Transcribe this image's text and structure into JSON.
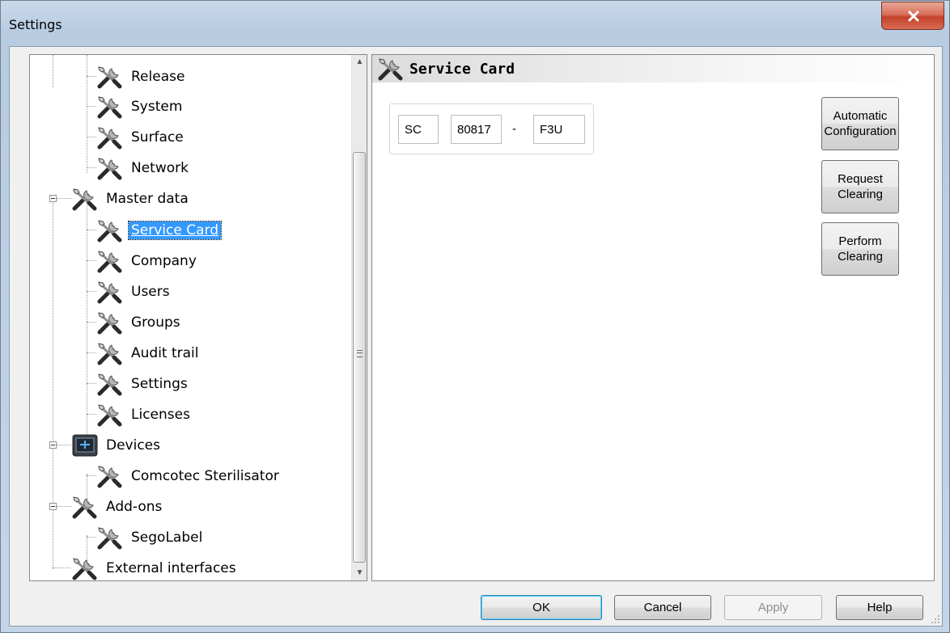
{
  "window": {
    "title": "Settings"
  },
  "tree": {
    "items": [
      {
        "label": "Release"
      },
      {
        "label": "System"
      },
      {
        "label": "Surface"
      },
      {
        "label": "Network"
      },
      {
        "label": "Master data"
      },
      {
        "label": "Service Card"
      },
      {
        "label": "Company"
      },
      {
        "label": "Users"
      },
      {
        "label": "Groups"
      },
      {
        "label": "Audit trail"
      },
      {
        "label": "Settings"
      },
      {
        "label": "Licenses"
      },
      {
        "label": "Devices"
      },
      {
        "label": "Comcotec Sterilisator"
      },
      {
        "label": "Add-ons"
      },
      {
        "label": "SegoLabel"
      },
      {
        "label": "External interfaces"
      }
    ],
    "selected": "Service Card"
  },
  "content": {
    "title": "Service Card",
    "service_card": {
      "prefix": "SC",
      "number": "80817",
      "separator": "-",
      "suffix": "F3U"
    },
    "buttons": {
      "automatic": "Automatic\nConfiguration",
      "request": "Request\nClearing",
      "perform": "Perform\nClearing"
    }
  },
  "footer": {
    "ok": "OK",
    "cancel": "Cancel",
    "apply": "Apply",
    "help": "Help"
  },
  "icons": {
    "close": "close-icon",
    "tools": "tools-icon",
    "device": "device-icon"
  }
}
